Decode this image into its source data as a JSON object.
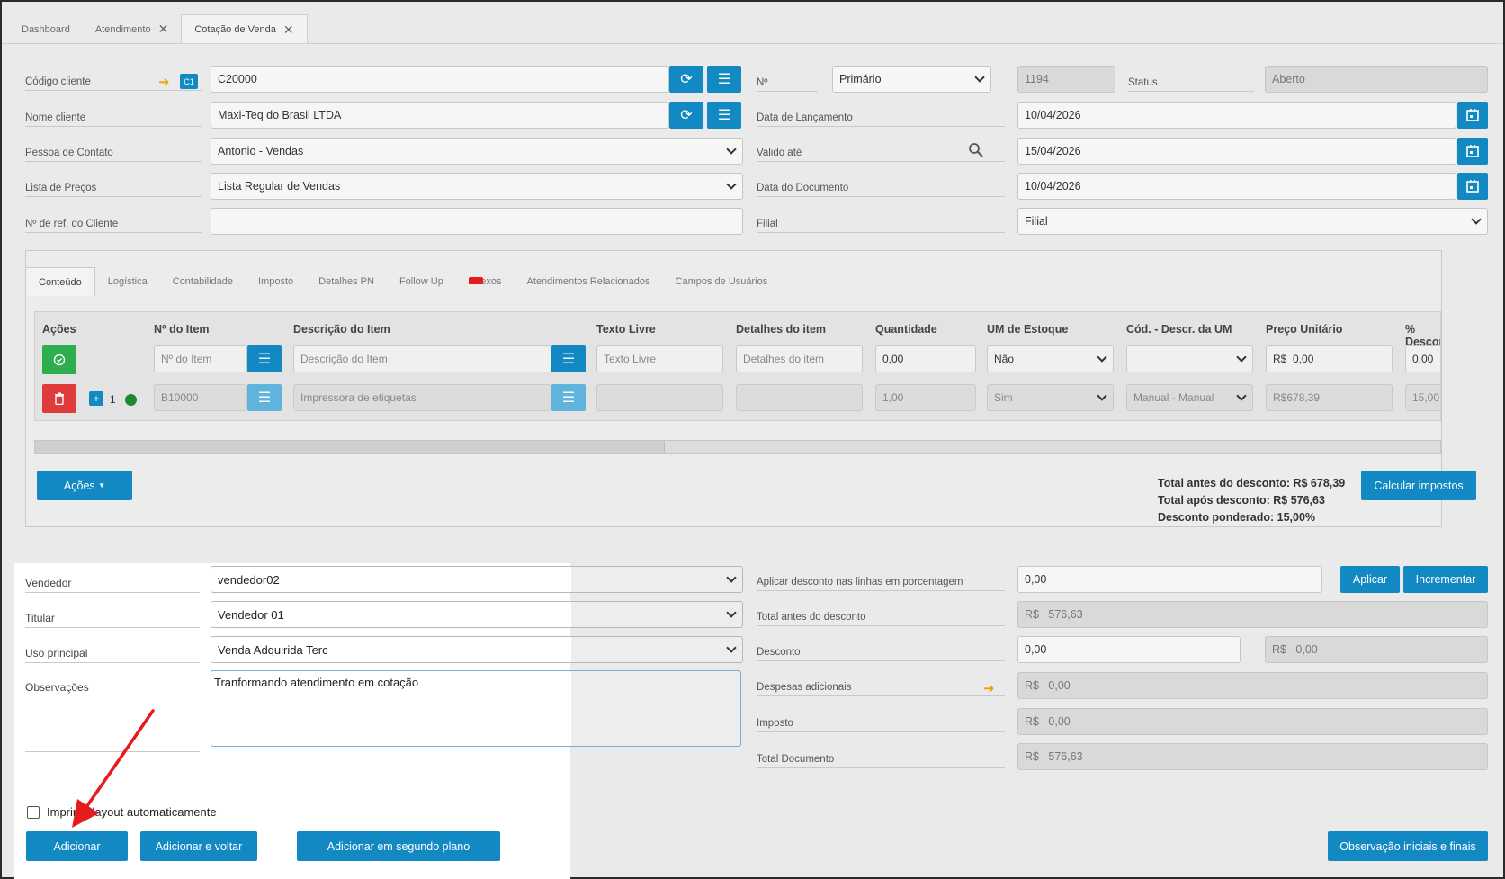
{
  "tabs": [
    {
      "label": "Dashboard",
      "closable": false,
      "active": false
    },
    {
      "label": "Atendimento",
      "closable": true,
      "active": false
    },
    {
      "label": "Cotação de Venda",
      "closable": true,
      "active": true
    }
  ],
  "header": {
    "codigo_cliente": {
      "label": "Código cliente",
      "value": "C20000",
      "badge": "C1"
    },
    "nome_cliente": {
      "label": "Nome cliente",
      "value": "Maxi-Teq do Brasil LTDA"
    },
    "pessoa_contato": {
      "label": "Pessoa de Contato",
      "value": "Antonio - Vendas"
    },
    "lista_precos": {
      "label": "Lista de Preços",
      "value": "Lista Regular de Vendas"
    },
    "ref_cliente": {
      "label": "Nº de ref. do Cliente",
      "value": ""
    },
    "numero": {
      "label": "Nº",
      "series": "Primário",
      "value": "1194"
    },
    "status": {
      "label": "Status",
      "value": "Aberto"
    },
    "data_lancamento": {
      "label": "Data de Lançamento",
      "value": "10/04/2026"
    },
    "valido_ate": {
      "label": "Valido até",
      "value": "15/04/2026"
    },
    "data_documento": {
      "label": "Data do Documento",
      "value": "10/04/2026"
    },
    "filial": {
      "label": "Filial",
      "value": "Filial"
    }
  },
  "subtabs": [
    "Conteúdo",
    "Logística",
    "Contabilidade",
    "Imposto",
    "Detalhes PN",
    "Follow Up",
    "Anexos",
    "Atendimentos Relacionados",
    "Campos de Usuários"
  ],
  "subtab_badge": "",
  "grid": {
    "headers": [
      "Ações",
      "Nº do Item",
      "Descrição do Item",
      "Texto Livre",
      "Detalhes do item",
      "Quantidade",
      "UM de Estoque",
      "Cód. - Descr. da UM",
      "Preço Unitário",
      "% Desconto"
    ],
    "new_row": {
      "item_placeholder": "Nº do Item",
      "desc_placeholder": "Descrição do Item",
      "texto_placeholder": "Texto Livre",
      "detalhes_placeholder": "Detalhes do item",
      "quantidade": "0,00",
      "um_estoque": "Não",
      "cod_um": "",
      "preco_currency": "R$",
      "preco": "0,00",
      "desconto": "0,00"
    },
    "row": {
      "line": "1",
      "item": "B10000",
      "desc": "Impressora de etiquetas",
      "quantidade": "1,00",
      "um_estoque": "Sim",
      "cod_um": "Manual - Manual",
      "preco": "R$678,39",
      "desconto": "15,00"
    }
  },
  "acoes_label": "Ações",
  "totals": {
    "antes": "Total antes do desconto: R$ 678,39",
    "apos": "Total após desconto: R$ 576,63",
    "ponderado": "Desconto ponderado: 15,00%"
  },
  "calcular_label": "Calcular impostos",
  "footer_left": {
    "vendedor": {
      "label": "Vendedor",
      "value": "vendedor02"
    },
    "titular": {
      "label": "Titular",
      "value": "Vendedor 01"
    },
    "uso": {
      "label": "Uso principal",
      "value": "Venda Adquirida Terc"
    },
    "obs": {
      "label": "Observações",
      "value": "Tranformando atendimento em cotação"
    }
  },
  "footer_right": {
    "aplicar_desc": {
      "label": "Aplicar desconto nas linhas em porcentagem",
      "value": "0,00"
    },
    "aplicar_btn": "Aplicar",
    "incrementar_btn": "Incrementar",
    "total_antes": {
      "label": "Total antes do desconto",
      "currency": "R$",
      "value": "576,63"
    },
    "desconto": {
      "label": "Desconto",
      "value": "0,00",
      "currency": "R$",
      "value2": "0,00"
    },
    "despesas": {
      "label": "Despesas adicionais",
      "currency": "R$",
      "value": "0,00"
    },
    "imposto": {
      "label": "Imposto",
      "currency": "R$",
      "value": "0,00"
    },
    "total_doc": {
      "label": "Total Documento",
      "currency": "R$",
      "value": "576,63"
    }
  },
  "imprimir_label": "Imprimir layout automaticamente",
  "buttons": {
    "adicionar": "Adicionar",
    "adicionar_voltar": "Adicionar e voltar",
    "adicionar_segundo": "Adicionar em segundo plano",
    "observacao": "Observação iniciais e finais"
  },
  "colors": {
    "primary": "#1289c2",
    "success": "#2eae4f",
    "danger": "#e03b3b",
    "annotation": "#e51c1c",
    "arrow": "#f0a000"
  }
}
